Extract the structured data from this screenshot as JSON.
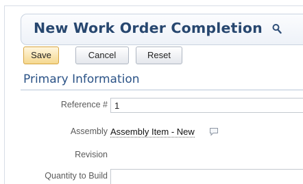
{
  "form": {
    "title": "New Work Order Completion",
    "search_icon": "magnifier-icon"
  },
  "toolbar": {
    "save_label": "Save",
    "cancel_label": "Cancel",
    "reset_label": "Reset"
  },
  "section": {
    "title": "Primary Information"
  },
  "fields": {
    "reference": {
      "label": "Reference #",
      "value": "1"
    },
    "assembly": {
      "label": "Assembly",
      "value": "Assembly Item - New",
      "icon": "comment-icon"
    },
    "revision": {
      "label": "Revision",
      "value": ""
    },
    "quantity": {
      "label": "Quantity to Build",
      "value": ""
    }
  },
  "colors": {
    "title": "#27476f",
    "section_title": "#2a5286",
    "save_button": "#f5d88f"
  }
}
